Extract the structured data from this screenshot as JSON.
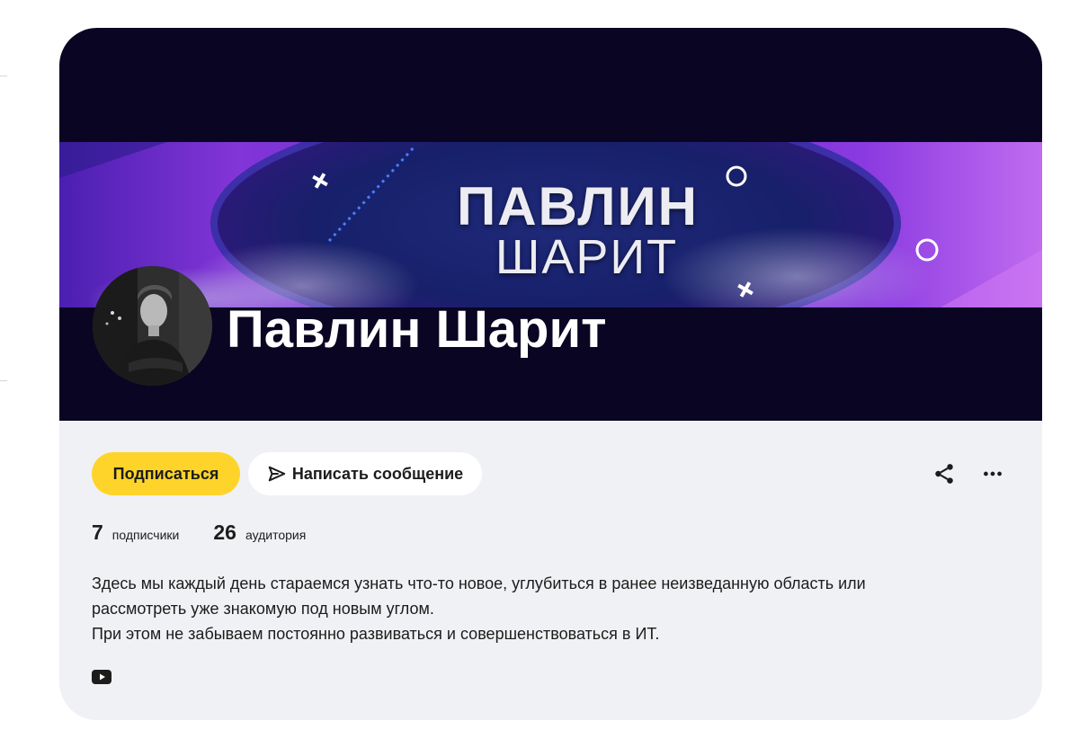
{
  "channel": {
    "name": "Павлин Шарит",
    "banner_title_line1": "ПАВЛИН",
    "banner_title_line2": "ШАРИТ"
  },
  "actions": {
    "subscribe_label": "Подписаться",
    "message_label": "Написать сообщение",
    "share_icon": "share-icon",
    "more_icon": "more-icon"
  },
  "stats": [
    {
      "value": "7",
      "label": "подписчики"
    },
    {
      "value": "26",
      "label": "аудитория"
    }
  ],
  "description": [
    "Здесь мы каждый день стараемся узнать что-то новое, углубиться в ранее неизведанную область или",
    "рассмотреть уже знакомую под новым углом.",
    "При этом не забываем постоянно развиваться и совершенствоваться в ИТ."
  ],
  "links": [
    {
      "icon": "youtube-icon"
    }
  ],
  "colors": {
    "subscribe": "#fed42b",
    "card_background": "#f0f1f4",
    "cover_background": "#0a0522",
    "banner_purple": "#8235d8"
  }
}
